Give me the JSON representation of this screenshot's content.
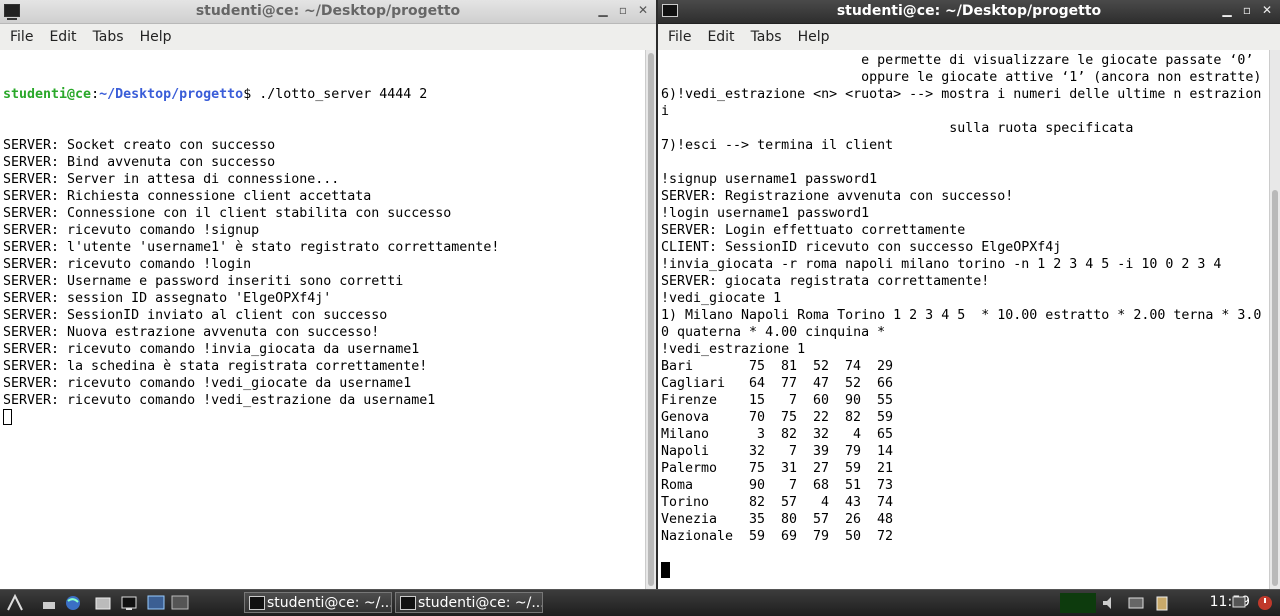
{
  "left_window": {
    "title": "studenti@ce: ~/Desktop/progetto",
    "menu": [
      "File",
      "Edit",
      "Tabs",
      "Help"
    ],
    "prompt": {
      "user": "studenti@ce",
      "sep": ":",
      "path": "~/Desktop/progetto",
      "suffix": "$ ",
      "command": "./lotto_server 4444 2"
    },
    "lines": [
      "SERVER: Socket creato con successo",
      "SERVER: Bind avvenuta con successo",
      "SERVER: Server in attesa di connessione...",
      "SERVER: Richiesta connessione client accettata",
      "SERVER: Connessione con il client stabilita con successo",
      "SERVER: ricevuto comando !signup",
      "SERVER: l'utente 'username1' è stato registrato correttamente!",
      "SERVER: ricevuto comando !login",
      "SERVER: Username e password inseriti sono corretti",
      "SERVER: session ID assegnato 'ElgeOPXf4j'",
      "SERVER: SessionID inviato al client con successo",
      "SERVER: Nuova estrazione avvenuta con successo!",
      "SERVER: ricevuto comando !invia_giocata da username1",
      "SERVER: la schedina è stata registrata correttamente!",
      "SERVER: ricevuto comando !vedi_giocate da username1",
      "SERVER: ricevuto comando !vedi_estrazione da username1"
    ]
  },
  "right_window": {
    "title": "studenti@ce: ~/Desktop/progetto",
    "menu": [
      "File",
      "Edit",
      "Tabs",
      "Help"
    ],
    "lines": [
      "                         e permette di visualizzare le giocate passate ‘0’",
      "                         oppure le giocate attive ‘1’ (ancora non estratte)",
      "6)!vedi_estrazione <n> <ruota> --> mostra i numeri delle ultime n estrazion",
      "i",
      "                                    sulla ruota specificata",
      "7)!esci --> termina il client",
      "",
      "!signup username1 password1",
      "SERVER: Registrazione avvenuta con successo!",
      "!login username1 password1",
      "SERVER: Login effettuato correttamente",
      "CLIENT: SessionID ricevuto con successo ElgeOPXf4j",
      "!invia_giocata -r roma napoli milano torino -n 1 2 3 4 5 -i 10 0 2 3 4",
      "SERVER: giocata registrata correttamente!",
      "!vedi_giocate 1",
      "1) Milano Napoli Roma Torino 1 2 3 4 5  * 10.00 estratto * 2.00 terna * 3.0",
      "0 quaterna * 4.00 cinquina *",
      "!vedi_estrazione 1"
    ],
    "extraction_table": [
      {
        "ruota": "Bari",
        "numbers": [
          "75",
          "81",
          "52",
          "74",
          "29"
        ]
      },
      {
        "ruota": "Cagliari",
        "numbers": [
          "64",
          "77",
          "47",
          "52",
          "66"
        ]
      },
      {
        "ruota": "Firenze",
        "numbers": [
          "15",
          "7",
          "60",
          "90",
          "55"
        ]
      },
      {
        "ruota": "Genova",
        "numbers": [
          "70",
          "75",
          "22",
          "82",
          "59"
        ]
      },
      {
        "ruota": "Milano",
        "numbers": [
          "3",
          "82",
          "32",
          "4",
          "65"
        ]
      },
      {
        "ruota": "Napoli",
        "numbers": [
          "32",
          "7",
          "39",
          "79",
          "14"
        ]
      },
      {
        "ruota": "Palermo",
        "numbers": [
          "75",
          "31",
          "27",
          "59",
          "21"
        ]
      },
      {
        "ruota": "Roma",
        "numbers": [
          "90",
          "7",
          "68",
          "51",
          "73"
        ]
      },
      {
        "ruota": "Torino",
        "numbers": [
          "82",
          "57",
          "4",
          "43",
          "74"
        ]
      },
      {
        "ruota": "Venezia",
        "numbers": [
          "35",
          "80",
          "57",
          "26",
          "48"
        ]
      },
      {
        "ruota": "Nazionale",
        "numbers": [
          "59",
          "69",
          "79",
          "50",
          "72"
        ]
      }
    ]
  },
  "taskbar": {
    "tasks": [
      "studenti@ce: ~/...",
      "studenti@ce: ~/..."
    ],
    "clock": "11:59"
  }
}
